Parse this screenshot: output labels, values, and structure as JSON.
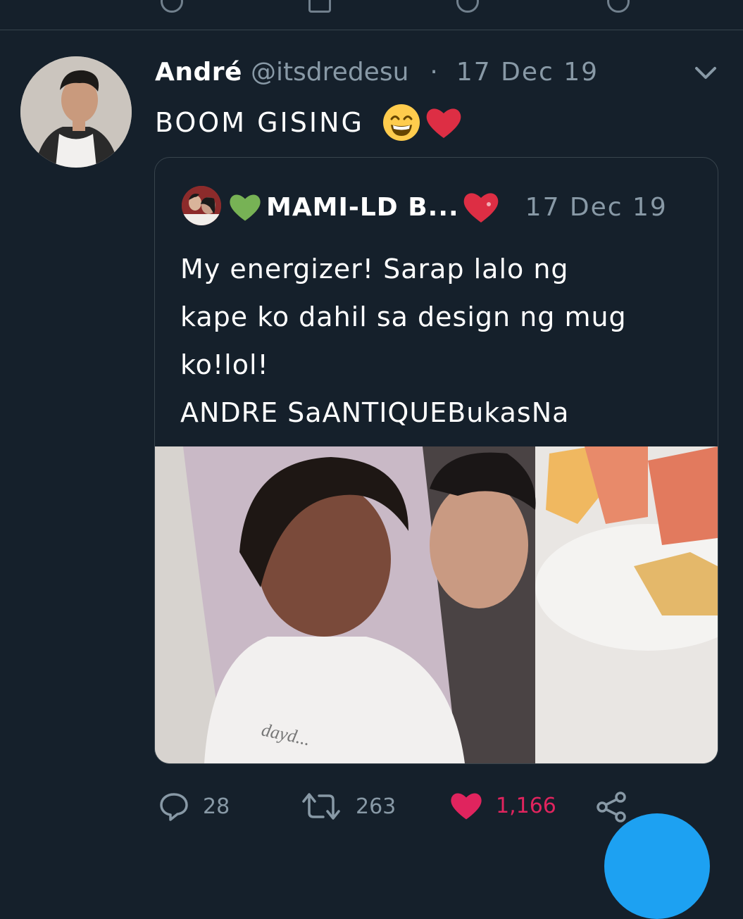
{
  "tweet": {
    "author_name": "André",
    "author_handle": "@itsdredesu",
    "separator": "·",
    "date": "17 Dec 19",
    "text": "BOOM GISING",
    "emoji": [
      "grinning-face",
      "red-heart"
    ]
  },
  "quoted_tweet": {
    "author_name": "MAMI-LD B...",
    "date": "17 Dec 19",
    "text_lines": [
      "My energizer! Sarap lalo ng",
      "kape ko dahil sa design ng mug",
      "ko!lol!",
      "ANDRE SaANTIQUEBukasNa"
    ],
    "media_description_icon": "photo"
  },
  "actions": {
    "reply_count": "28",
    "retweet_count": "263",
    "like_count": "1,166"
  },
  "colors": {
    "background": "#15202b",
    "secondary_text": "#8899a6",
    "border": "#38444d",
    "like": "#e0245e",
    "accent": "#1da1f2"
  }
}
